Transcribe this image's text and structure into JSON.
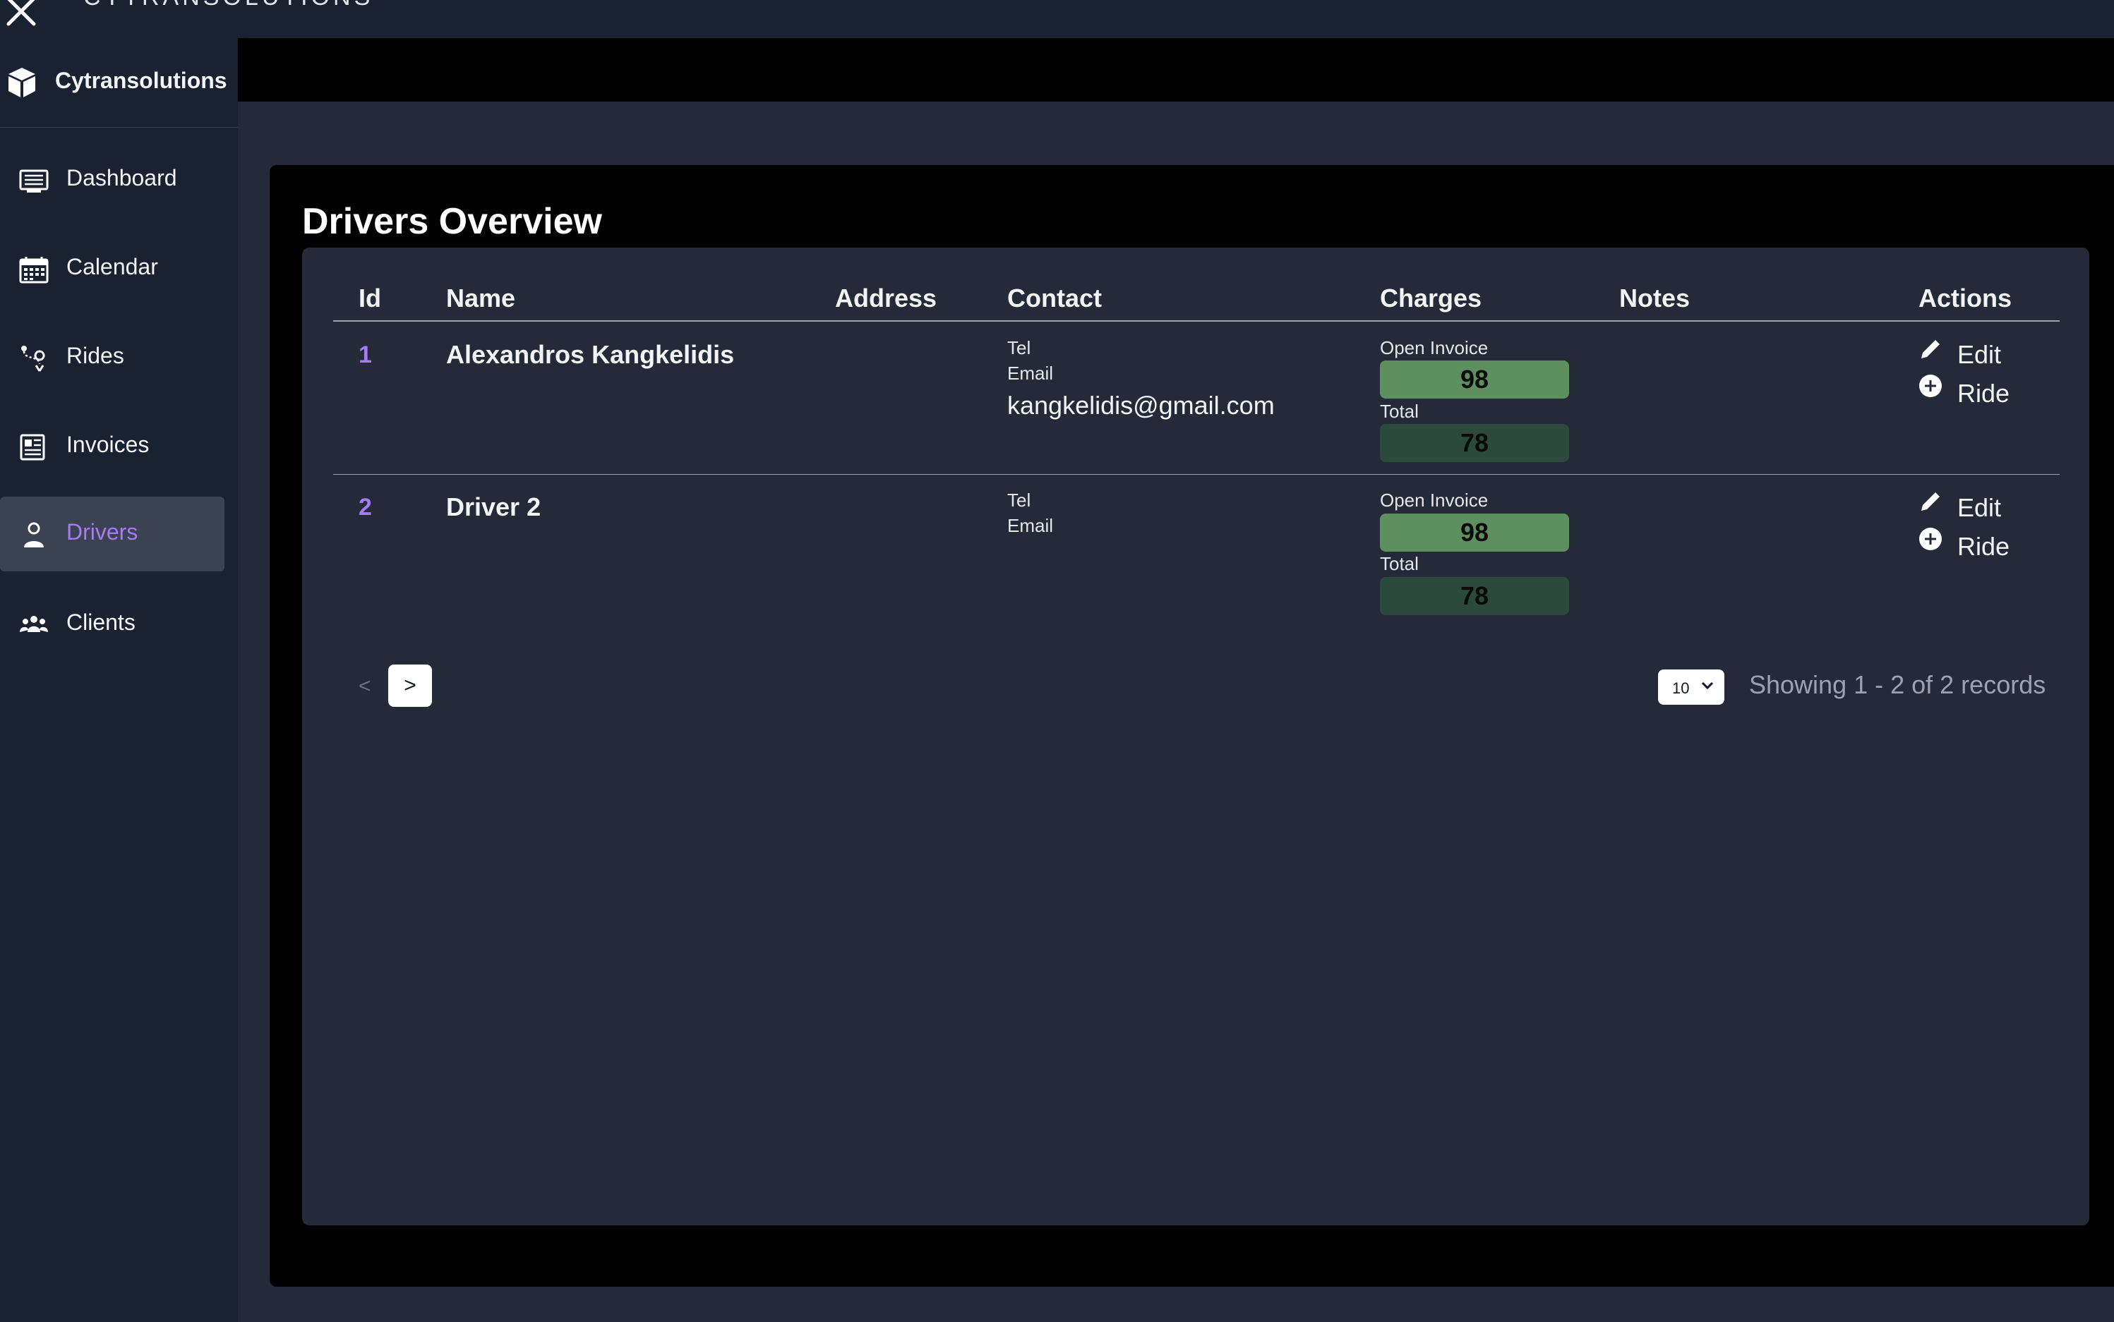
{
  "window": {
    "title": "CYTRANSOLUTIONS"
  },
  "sidebar": {
    "brand": "Cytransolutions",
    "items": [
      {
        "label": "Dashboard",
        "icon": "dashboard-icon"
      },
      {
        "label": "Calendar",
        "icon": "calendar-icon"
      },
      {
        "label": "Rides",
        "icon": "rides-icon"
      },
      {
        "label": "Invoices",
        "icon": "invoices-icon"
      },
      {
        "label": "Drivers",
        "icon": "drivers-icon",
        "active": true
      },
      {
        "label": "Clients",
        "icon": "clients-icon"
      }
    ]
  },
  "page": {
    "title": "Drivers Overview"
  },
  "table": {
    "columns": [
      "Id",
      "Name",
      "Address",
      "Contact",
      "Charges",
      "Notes",
      "Actions"
    ],
    "rows": [
      {
        "id": "1",
        "name": "Alexandros Kangkelidis",
        "tel_label": "Tel",
        "email_label": "Email",
        "email": "kangkelidis@gmail.com",
        "open_invoice_label": "Open Invoice",
        "open_invoice": "98",
        "total_label": "Total",
        "total": "78",
        "edit_label": "Edit",
        "ride_label": "Ride"
      },
      {
        "id": "2",
        "name": "Driver 2",
        "tel_label": "Tel",
        "email_label": "Email",
        "email": "",
        "open_invoice_label": "Open Invoice",
        "open_invoice": "98",
        "total_label": "Total",
        "total": "78",
        "edit_label": "Edit",
        "ride_label": "Ride"
      }
    ]
  },
  "pagination": {
    "prev": "<",
    "next": ">",
    "per_page": "10",
    "showing": "Showing 1 - 2 of 2 records"
  },
  "colors": {
    "accent": "#a77bf3",
    "sidebar_bg": "#1a2131",
    "content_bg": "#242a37",
    "open_invoice_bg": "#5e8f5e",
    "total_bg": "#2b4a3d"
  }
}
